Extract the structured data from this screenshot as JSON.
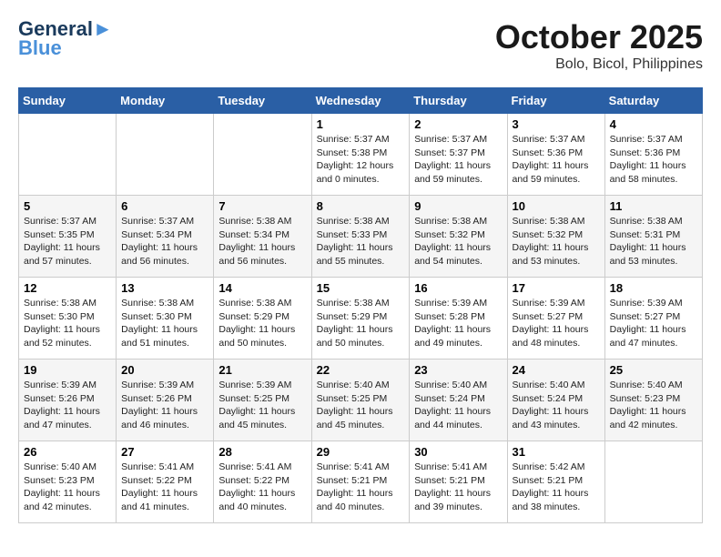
{
  "header": {
    "logo_line1": "General",
    "logo_line2": "Blue",
    "month": "October 2025",
    "location": "Bolo, Bicol, Philippines"
  },
  "weekdays": [
    "Sunday",
    "Monday",
    "Tuesday",
    "Wednesday",
    "Thursday",
    "Friday",
    "Saturday"
  ],
  "weeks": [
    [
      {
        "day": "",
        "sunrise": "",
        "sunset": "",
        "daylight": ""
      },
      {
        "day": "",
        "sunrise": "",
        "sunset": "",
        "daylight": ""
      },
      {
        "day": "",
        "sunrise": "",
        "sunset": "",
        "daylight": ""
      },
      {
        "day": "1",
        "sunrise": "Sunrise: 5:37 AM",
        "sunset": "Sunset: 5:38 PM",
        "daylight": "Daylight: 12 hours and 0 minutes."
      },
      {
        "day": "2",
        "sunrise": "Sunrise: 5:37 AM",
        "sunset": "Sunset: 5:37 PM",
        "daylight": "Daylight: 11 hours and 59 minutes."
      },
      {
        "day": "3",
        "sunrise": "Sunrise: 5:37 AM",
        "sunset": "Sunset: 5:36 PM",
        "daylight": "Daylight: 11 hours and 59 minutes."
      },
      {
        "day": "4",
        "sunrise": "Sunrise: 5:37 AM",
        "sunset": "Sunset: 5:36 PM",
        "daylight": "Daylight: 11 hours and 58 minutes."
      }
    ],
    [
      {
        "day": "5",
        "sunrise": "Sunrise: 5:37 AM",
        "sunset": "Sunset: 5:35 PM",
        "daylight": "Daylight: 11 hours and 57 minutes."
      },
      {
        "day": "6",
        "sunrise": "Sunrise: 5:37 AM",
        "sunset": "Sunset: 5:34 PM",
        "daylight": "Daylight: 11 hours and 56 minutes."
      },
      {
        "day": "7",
        "sunrise": "Sunrise: 5:38 AM",
        "sunset": "Sunset: 5:34 PM",
        "daylight": "Daylight: 11 hours and 56 minutes."
      },
      {
        "day": "8",
        "sunrise": "Sunrise: 5:38 AM",
        "sunset": "Sunset: 5:33 PM",
        "daylight": "Daylight: 11 hours and 55 minutes."
      },
      {
        "day": "9",
        "sunrise": "Sunrise: 5:38 AM",
        "sunset": "Sunset: 5:32 PM",
        "daylight": "Daylight: 11 hours and 54 minutes."
      },
      {
        "day": "10",
        "sunrise": "Sunrise: 5:38 AM",
        "sunset": "Sunset: 5:32 PM",
        "daylight": "Daylight: 11 hours and 53 minutes."
      },
      {
        "day": "11",
        "sunrise": "Sunrise: 5:38 AM",
        "sunset": "Sunset: 5:31 PM",
        "daylight": "Daylight: 11 hours and 53 minutes."
      }
    ],
    [
      {
        "day": "12",
        "sunrise": "Sunrise: 5:38 AM",
        "sunset": "Sunset: 5:30 PM",
        "daylight": "Daylight: 11 hours and 52 minutes."
      },
      {
        "day": "13",
        "sunrise": "Sunrise: 5:38 AM",
        "sunset": "Sunset: 5:30 PM",
        "daylight": "Daylight: 11 hours and 51 minutes."
      },
      {
        "day": "14",
        "sunrise": "Sunrise: 5:38 AM",
        "sunset": "Sunset: 5:29 PM",
        "daylight": "Daylight: 11 hours and 50 minutes."
      },
      {
        "day": "15",
        "sunrise": "Sunrise: 5:38 AM",
        "sunset": "Sunset: 5:29 PM",
        "daylight": "Daylight: 11 hours and 50 minutes."
      },
      {
        "day": "16",
        "sunrise": "Sunrise: 5:39 AM",
        "sunset": "Sunset: 5:28 PM",
        "daylight": "Daylight: 11 hours and 49 minutes."
      },
      {
        "day": "17",
        "sunrise": "Sunrise: 5:39 AM",
        "sunset": "Sunset: 5:27 PM",
        "daylight": "Daylight: 11 hours and 48 minutes."
      },
      {
        "day": "18",
        "sunrise": "Sunrise: 5:39 AM",
        "sunset": "Sunset: 5:27 PM",
        "daylight": "Daylight: 11 hours and 47 minutes."
      }
    ],
    [
      {
        "day": "19",
        "sunrise": "Sunrise: 5:39 AM",
        "sunset": "Sunset: 5:26 PM",
        "daylight": "Daylight: 11 hours and 47 minutes."
      },
      {
        "day": "20",
        "sunrise": "Sunrise: 5:39 AM",
        "sunset": "Sunset: 5:26 PM",
        "daylight": "Daylight: 11 hours and 46 minutes."
      },
      {
        "day": "21",
        "sunrise": "Sunrise: 5:39 AM",
        "sunset": "Sunset: 5:25 PM",
        "daylight": "Daylight: 11 hours and 45 minutes."
      },
      {
        "day": "22",
        "sunrise": "Sunrise: 5:40 AM",
        "sunset": "Sunset: 5:25 PM",
        "daylight": "Daylight: 11 hours and 45 minutes."
      },
      {
        "day": "23",
        "sunrise": "Sunrise: 5:40 AM",
        "sunset": "Sunset: 5:24 PM",
        "daylight": "Daylight: 11 hours and 44 minutes."
      },
      {
        "day": "24",
        "sunrise": "Sunrise: 5:40 AM",
        "sunset": "Sunset: 5:24 PM",
        "daylight": "Daylight: 11 hours and 43 minutes."
      },
      {
        "day": "25",
        "sunrise": "Sunrise: 5:40 AM",
        "sunset": "Sunset: 5:23 PM",
        "daylight": "Daylight: 11 hours and 42 minutes."
      }
    ],
    [
      {
        "day": "26",
        "sunrise": "Sunrise: 5:40 AM",
        "sunset": "Sunset: 5:23 PM",
        "daylight": "Daylight: 11 hours and 42 minutes."
      },
      {
        "day": "27",
        "sunrise": "Sunrise: 5:41 AM",
        "sunset": "Sunset: 5:22 PM",
        "daylight": "Daylight: 11 hours and 41 minutes."
      },
      {
        "day": "28",
        "sunrise": "Sunrise: 5:41 AM",
        "sunset": "Sunset: 5:22 PM",
        "daylight": "Daylight: 11 hours and 40 minutes."
      },
      {
        "day": "29",
        "sunrise": "Sunrise: 5:41 AM",
        "sunset": "Sunset: 5:21 PM",
        "daylight": "Daylight: 11 hours and 40 minutes."
      },
      {
        "day": "30",
        "sunrise": "Sunrise: 5:41 AM",
        "sunset": "Sunset: 5:21 PM",
        "daylight": "Daylight: 11 hours and 39 minutes."
      },
      {
        "day": "31",
        "sunrise": "Sunrise: 5:42 AM",
        "sunset": "Sunset: 5:21 PM",
        "daylight": "Daylight: 11 hours and 38 minutes."
      },
      {
        "day": "",
        "sunrise": "",
        "sunset": "",
        "daylight": ""
      }
    ]
  ]
}
